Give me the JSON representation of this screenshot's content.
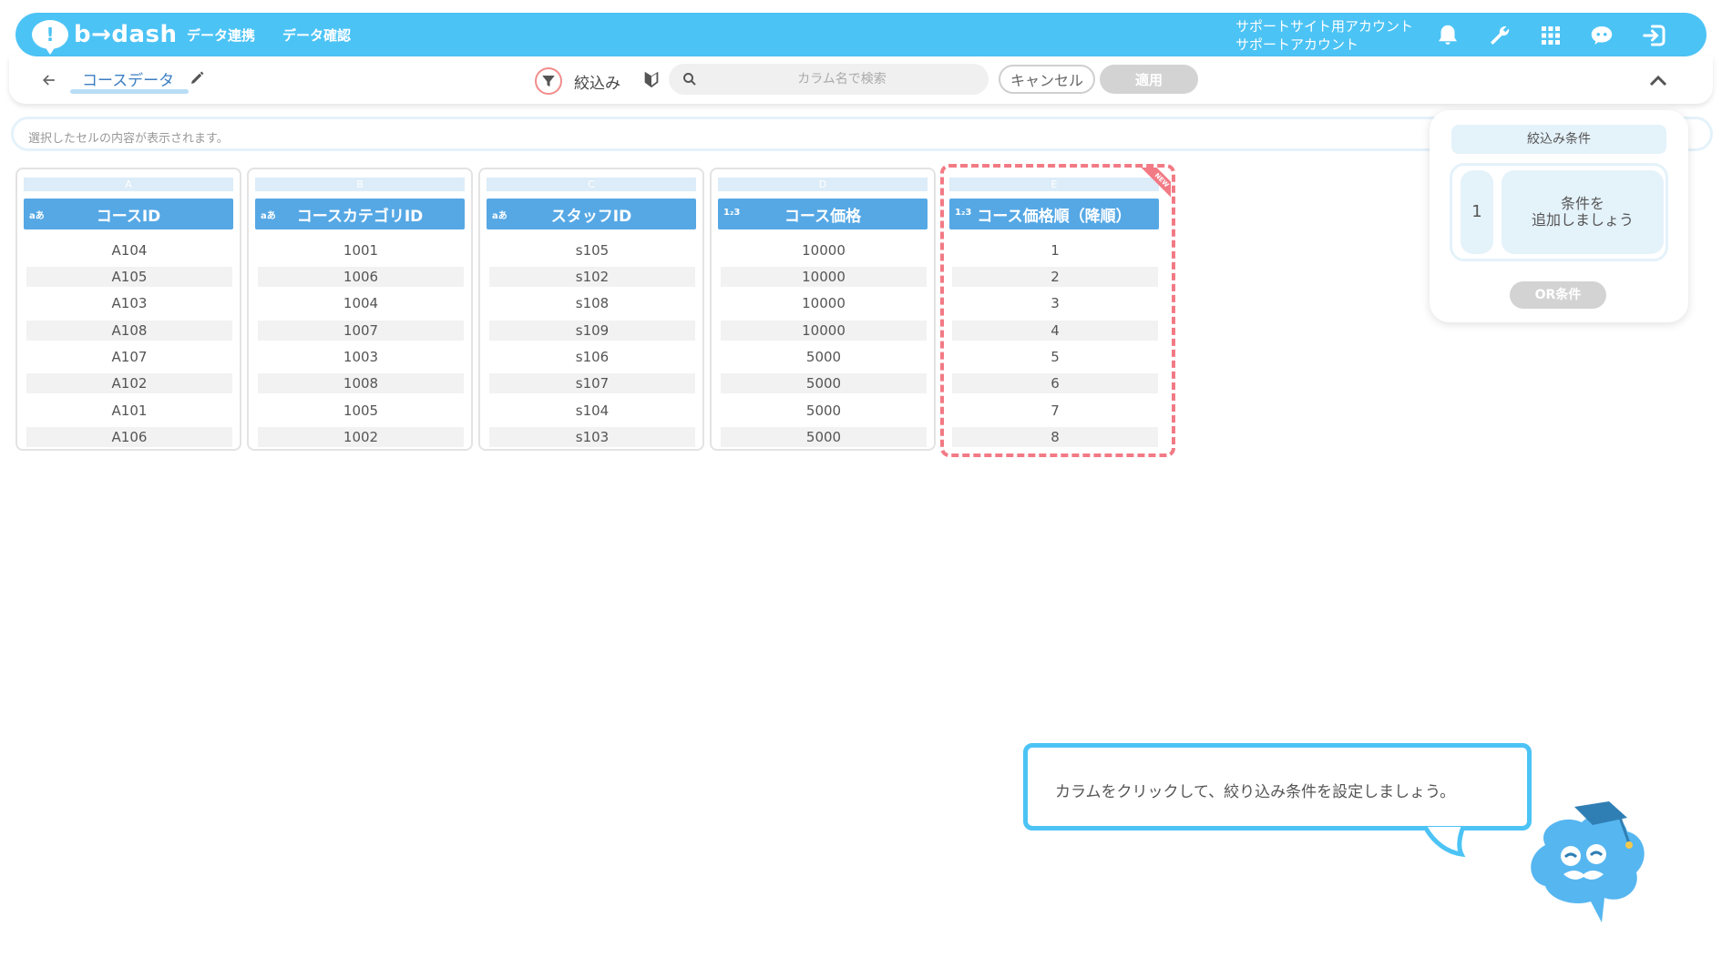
{
  "app": {
    "logo_text": "b→dash",
    "nav": [
      "データ連携",
      "データ確認"
    ],
    "account_line1": "サポートサイト用アカウント",
    "account_line2": "サポートアカウント"
  },
  "toolbar": {
    "breadcrumb": "コースデータ",
    "filter_label": "絞込み",
    "search_placeholder": "カラム名で検索",
    "cancel_label": "キャンセル",
    "apply_label": "適用"
  },
  "cell_bar": {
    "placeholder": "選択したセルの内容が表示されます。"
  },
  "columns": [
    {
      "letter": "A",
      "type": "aあ",
      "header": "コースID",
      "values": [
        "A104",
        "A105",
        "A103",
        "A108",
        "A107",
        "A102",
        "A101",
        "A106"
      ]
    },
    {
      "letter": "B",
      "type": "aあ",
      "header": "コースカテゴリID",
      "values": [
        "1001",
        "1006",
        "1004",
        "1007",
        "1003",
        "1008",
        "1005",
        "1002"
      ]
    },
    {
      "letter": "C",
      "type": "aあ",
      "header": "スタッフID",
      "values": [
        "s105",
        "s102",
        "s108",
        "s109",
        "s106",
        "s107",
        "s104",
        "s103"
      ]
    },
    {
      "letter": "D",
      "type": "1₂3",
      "header": "コース価格",
      "values": [
        "10000",
        "10000",
        "10000",
        "10000",
        "5000",
        "5000",
        "5000",
        "5000"
      ]
    },
    {
      "letter": "E",
      "type": "1₂3",
      "header": "コース価格順（降順）",
      "values": [
        "1",
        "2",
        "3",
        "4",
        "5",
        "6",
        "7",
        "8"
      ]
    }
  ],
  "new_badge": "NEW",
  "filter_panel": {
    "title": "絞込み条件",
    "condition_number": "1",
    "add_line1": "条件を",
    "add_line2": "追加しましょう",
    "or_label": "OR条件"
  },
  "tooltip": {
    "text": "カラムをクリックして、絞り込み条件を設定しましょう。"
  },
  "colors": {
    "brand": "#4cc3f5",
    "header_cell": "#56a8e5",
    "highlight": "#f27a85"
  }
}
